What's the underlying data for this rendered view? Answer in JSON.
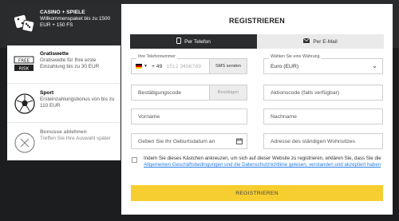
{
  "sidebar": {
    "bonuses": [
      {
        "title": "CASINO + SPIELE",
        "desc": "Willkommenspaket bis zu 1500 EUR + 150 FS"
      },
      {
        "title": "Gratiswette",
        "desc": "Gratiswette für Ihre erste Einzahlung bis zu 30 EUR",
        "badge_top": "FREE",
        "badge_bottom": "RISK"
      },
      {
        "title": "Sport",
        "desc": "Ersteinzahlungsbonus von bis zu 110 EUR"
      },
      {
        "title": "Bonusse ablehnen",
        "desc": "Treffen Sie Ihre Auswahl später"
      }
    ]
  },
  "form": {
    "title": "REGISTRIEREN",
    "tabs": [
      {
        "label": "Per Telefon",
        "icon": "phone-icon",
        "active": true
      },
      {
        "label": "Per E-Mail",
        "icon": "envelope-icon",
        "active": false
      }
    ],
    "phone": {
      "label": "Ihre Telefonnummer",
      "country_code": "+ 49",
      "placeholder": "1512 3456789",
      "sms_button": "SMS senden"
    },
    "currency": {
      "label": "Wählen Sie eine Währung",
      "value": "Euro (EUR)"
    },
    "code": {
      "placeholder": "Bestätigungscode",
      "confirm_button": "Bestätigen"
    },
    "promo": {
      "placeholder": "Aktionscode (falls verfügbar)"
    },
    "first_name": {
      "placeholder": "Vorname"
    },
    "last_name": {
      "placeholder": "Nachname"
    },
    "dob": {
      "placeholder": "Geben Sie Ihr Geburtsdatum an"
    },
    "address": {
      "placeholder": "Adresse des ständigen Wohnsitzes"
    },
    "consent": {
      "text": "Indem Sie dieses Kästchen ankreuzen, um sich auf dieser Website zu registrieren, erklären Sie, dass Sie die ",
      "link": "Allgemeinen Geschäftsbedingungen und die Datenschutzrichtlinie gelesen, verstanden und akzeptiert haben"
    },
    "submit": "REGISTRIEREN"
  },
  "colors": {
    "accent": "#f7ce2f",
    "dark": "#2b2c2e",
    "link": "#2a7de1"
  }
}
